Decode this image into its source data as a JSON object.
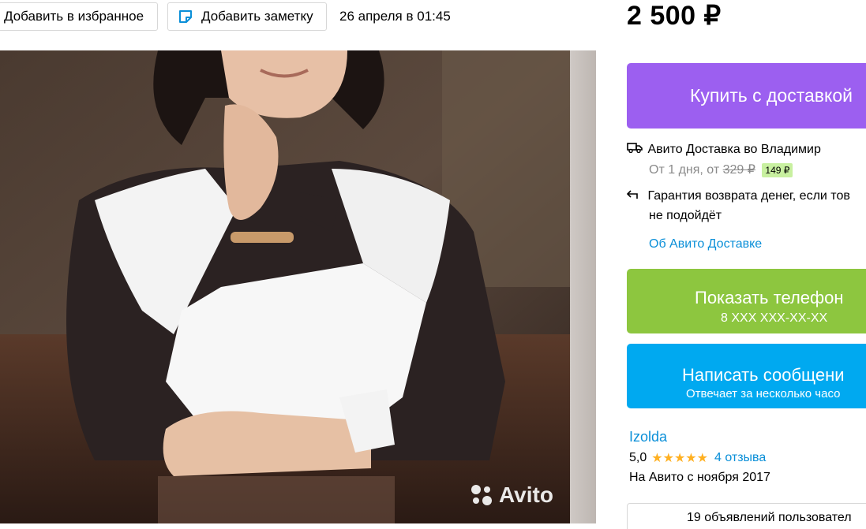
{
  "toolbar": {
    "favorite_label": "Добавить в избранное",
    "note_label": "Добавить заметку",
    "date": "26 апреля в 01:45"
  },
  "price": "2 500 ₽",
  "photo": {
    "watermark": "Avito"
  },
  "buy_button": {
    "label": "Купить с доставкой"
  },
  "delivery": {
    "title": "Авито Доставка во Владимир",
    "from_prefix": "От 1 дня, от",
    "old_price": "329 ₽",
    "new_price": "149 ₽",
    "guarantee_line1": "Гарантия возврата денег, если тов",
    "guarantee_line2": "не подойдёт",
    "about_link": "Об Авито Доставке"
  },
  "phone_button": {
    "label": "Показать телефон",
    "number": "8 XXX XXX-XX-XX"
  },
  "message_button": {
    "label": "Написать сообщени",
    "sub": "Отвечает за несколько часо"
  },
  "seller": {
    "name": "Izolda",
    "rating": "5,0",
    "stars": "★★★★★",
    "reviews": "4 отзыва",
    "since": "На Авито с ноября 2017",
    "ads_label": "19 объявлений пользовател"
  },
  "colors": {
    "buy": "#9c5ff0",
    "phone": "#8dc63f",
    "message": "#00a9f0",
    "link": "#0a8fd8",
    "star": "#ffb021"
  }
}
